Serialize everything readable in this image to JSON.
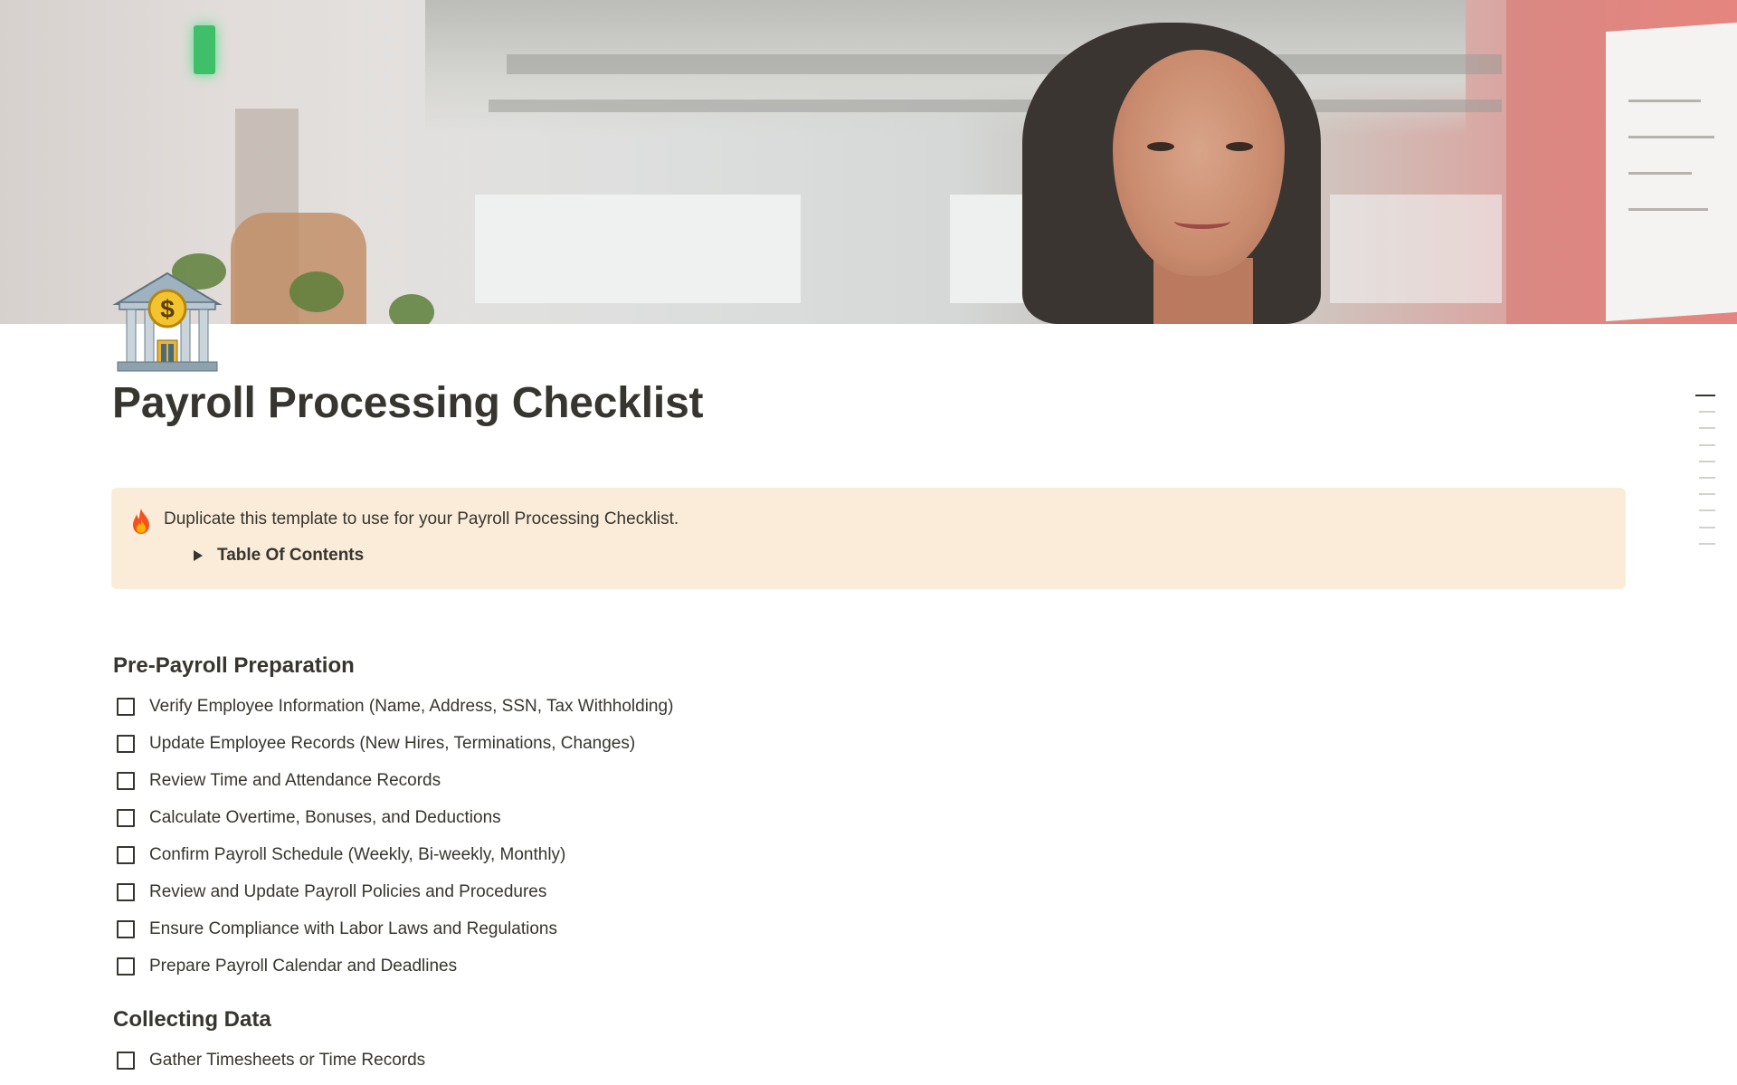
{
  "page": {
    "title": "Payroll Processing Checklist",
    "icon": "bank-icon",
    "cover": "cover-photo-woman-office"
  },
  "callout": {
    "icon": "fire-icon",
    "text": "Duplicate this template to use for your Payroll Processing Checklist.",
    "toggle_label": "Table Of Contents",
    "background": "#fbecd9"
  },
  "sections": [
    {
      "heading": "Pre-Payroll Preparation",
      "items": [
        "Verify Employee Information (Name, Address, SSN, Tax Withholding)",
        "Update Employee Records (New Hires, Terminations, Changes)",
        "Review Time and Attendance Records",
        "Calculate Overtime, Bonuses, and Deductions",
        "Confirm Payroll Schedule (Weekly, Bi-weekly, Monthly)",
        "Review and Update Payroll Policies and Procedures",
        "Ensure Compliance with Labor Laws and Regulations",
        "Prepare Payroll Calendar and Deadlines"
      ]
    },
    {
      "heading": "Collecting Data",
      "items": [
        "Gather Timesheets or Time Records"
      ]
    }
  ],
  "colors": {
    "text": "#37352f",
    "callout_bg": "#fbecd9",
    "toc_active": "#37352f",
    "toc_inactive": "#d3d1cc"
  }
}
